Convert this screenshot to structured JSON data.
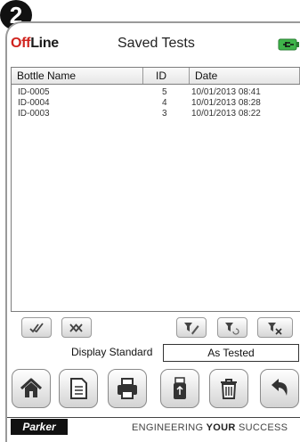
{
  "badge": "2",
  "header": {
    "logo_off": "Off",
    "logo_line": "Line",
    "title": "Saved Tests"
  },
  "table": {
    "columns": [
      "Bottle Name",
      "ID",
      "Date"
    ],
    "rows": [
      {
        "name": "ID-0005",
        "id": "5",
        "date": "10/01/2013 08:41"
      },
      {
        "name": "ID-0004",
        "id": "4",
        "date": "10/01/2013 08:28"
      },
      {
        "name": "ID-0003",
        "id": "3",
        "date": "10/01/2013 08:22"
      }
    ]
  },
  "toolbar": {
    "icons": [
      "select-all-icon",
      "deselect-all-icon",
      "filter-edit-icon",
      "filter-reset-icon",
      "filter-clear-icon"
    ]
  },
  "display_standard": {
    "label": "Display Standard",
    "value": "As Tested"
  },
  "bottom_bar": {
    "icons": [
      "home-icon",
      "document-icon",
      "printer-icon",
      "usb-icon",
      "trash-icon",
      "back-icon"
    ]
  },
  "footer": {
    "brand": "Parker",
    "tagline_prefix": "ENGINEERING ",
    "tagline_bold": "YOUR",
    "tagline_suffix": " SUCCESS"
  },
  "colors": {
    "logo_red": "#d0241f",
    "battery_green": "#3fb54a"
  }
}
